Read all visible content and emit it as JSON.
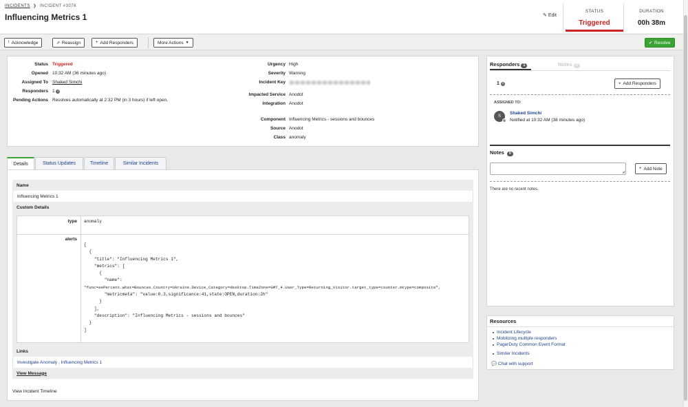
{
  "breadcrumb": {
    "incidents": "INCIDENTS",
    "sep": "❯",
    "current": "INCIDENT #3076"
  },
  "title": "Influencing Metrics 1",
  "header": {
    "edit_label": "Edit",
    "status_label": "STATUS",
    "status_value": "Triggered",
    "duration_label": "DURATION",
    "duration_value": "00h 38m"
  },
  "actions": {
    "acknowledge": "Acknowledge",
    "reassign": "Reassign",
    "add_responders": "Add Responders",
    "more_actions": "More Actions",
    "resolve": "Resolve"
  },
  "summary_left": [
    {
      "label": "Status",
      "value": "Triggered"
    },
    {
      "label": "Opened",
      "value": "10:32 AM (36 minutes ago)"
    },
    {
      "label": "Assigned To",
      "value": "Shaked Simchi"
    },
    {
      "label": "Responders",
      "value": "1"
    },
    {
      "label": "Pending Actions",
      "value": "Resolves automatically at 2:32 PM (in 3 hours) if left open."
    }
  ],
  "summary_right": [
    {
      "label": "Urgency",
      "value": "High"
    },
    {
      "label": "Severity",
      "value": "Warning"
    },
    {
      "label": "Incident Key",
      "value": ""
    },
    {
      "label": "Impacted Service",
      "value": "Anodot"
    },
    {
      "label": "Integration",
      "value": "Anodot"
    },
    {
      "label": "Component",
      "value": "Influencing Metrics - sessions and bounces"
    },
    {
      "label": "Source",
      "value": "Anodot"
    },
    {
      "label": "Class",
      "value": "anomaly"
    }
  ],
  "tabs": [
    "Details",
    "Status Updates",
    "Timeline",
    "Similar Incidents"
  ],
  "details": {
    "name_header": "Name",
    "name_value": "Influencing Metrics 1",
    "custom_header": "Custom Details",
    "type_label": "type",
    "type_value": "anomaly",
    "alerts_label": "alerts",
    "alerts_lines": [
      "[",
      "  {",
      "    \"title\": \"Influencing Metrics 1\",",
      "    \"metrics\": [",
      "      {",
      "        \"name\":",
      "\"func=asPercent.what=Bounces.Country=Ukraine.Device_Category=desktop.TimeZone=GMT_4.User_Type=Returning_Visitor.target_type=counter.mtype=composite\",",
      "        \"metricmeta\": \"value:0.3,significance:41,state:OPEN,duration:2h\"",
      "      }",
      "    ],",
      "    \"description\": \"Influencing Metrics - sessions and bounces\"",
      "  }",
      "]"
    ],
    "links_header": "Links",
    "links_value": "Investigate Anomaly , Influencing Metrics 1",
    "view_message": "View Message",
    "view_timeline": "View Incident Timeline"
  },
  "responders_panel": {
    "tab_responders": "Responders",
    "responders_count": "1",
    "tab_notes": "Notes",
    "notes_count": "0",
    "count": "1",
    "add_responders": "Add Responders",
    "assigned_to_label": "ASSIGNED TO:",
    "avatar_initial": "S",
    "assignee_name": "Shaked Simchi",
    "assignee_note": "Notified at 10:32 AM (38 minutes ago)"
  },
  "notes_panel": {
    "title": "Notes",
    "count": "0",
    "add_note": "Add Note",
    "empty": "There are no recent notes."
  },
  "resources": {
    "title": "Resources",
    "items": [
      "Incident Lifecycle",
      "Mobilizing multiple responders",
      "PagerDuty Common Event Format"
    ],
    "similar": "Similar Incidents",
    "chat": "Chat with support"
  }
}
